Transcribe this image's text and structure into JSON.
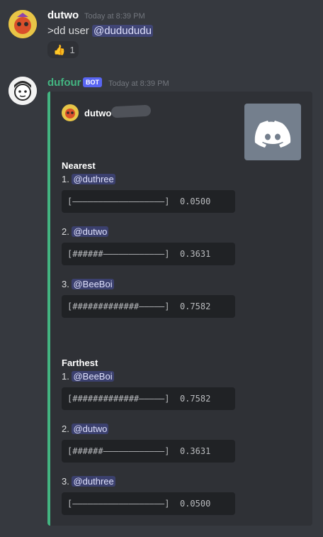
{
  "messages": [
    {
      "username": "dutwo",
      "username_color": "#ffffff",
      "timestamp": "Today at 8:39 PM",
      "text_prefix": ">dd user ",
      "mention": "@dudududu",
      "reaction": {
        "emoji": "👍",
        "count": "1"
      }
    },
    {
      "username": "dufour",
      "username_color": "#43b581",
      "bot_tag": "BOT",
      "timestamp": "Today at 8:39 PM",
      "embed": {
        "accent_color": "#43b581",
        "author": "dutwo",
        "thumbnail_icon": "discord-logo-icon",
        "nearest": {
          "title": "Nearest",
          "items": [
            {
              "rank": "1.",
              "mention": "@duthree",
              "bar": "[——————————————————]  0.0500"
            },
            {
              "rank": "2.",
              "mention": "@dutwo",
              "bar": "[######————————————]  0.3631"
            },
            {
              "rank": "3.",
              "mention": "@BeeBoi",
              "bar": "[#############—————]  0.7582"
            }
          ]
        },
        "farthest": {
          "title": "Farthest",
          "items": [
            {
              "rank": "1.",
              "mention": "@BeeBoi",
              "bar": "[#############—————]  0.7582"
            },
            {
              "rank": "2.",
              "mention": "@dutwo",
              "bar": "[######————————————]  0.3631"
            },
            {
              "rank": "3.",
              "mention": "@duthree",
              "bar": "[——————————————————]  0.0500"
            }
          ]
        }
      }
    }
  ]
}
